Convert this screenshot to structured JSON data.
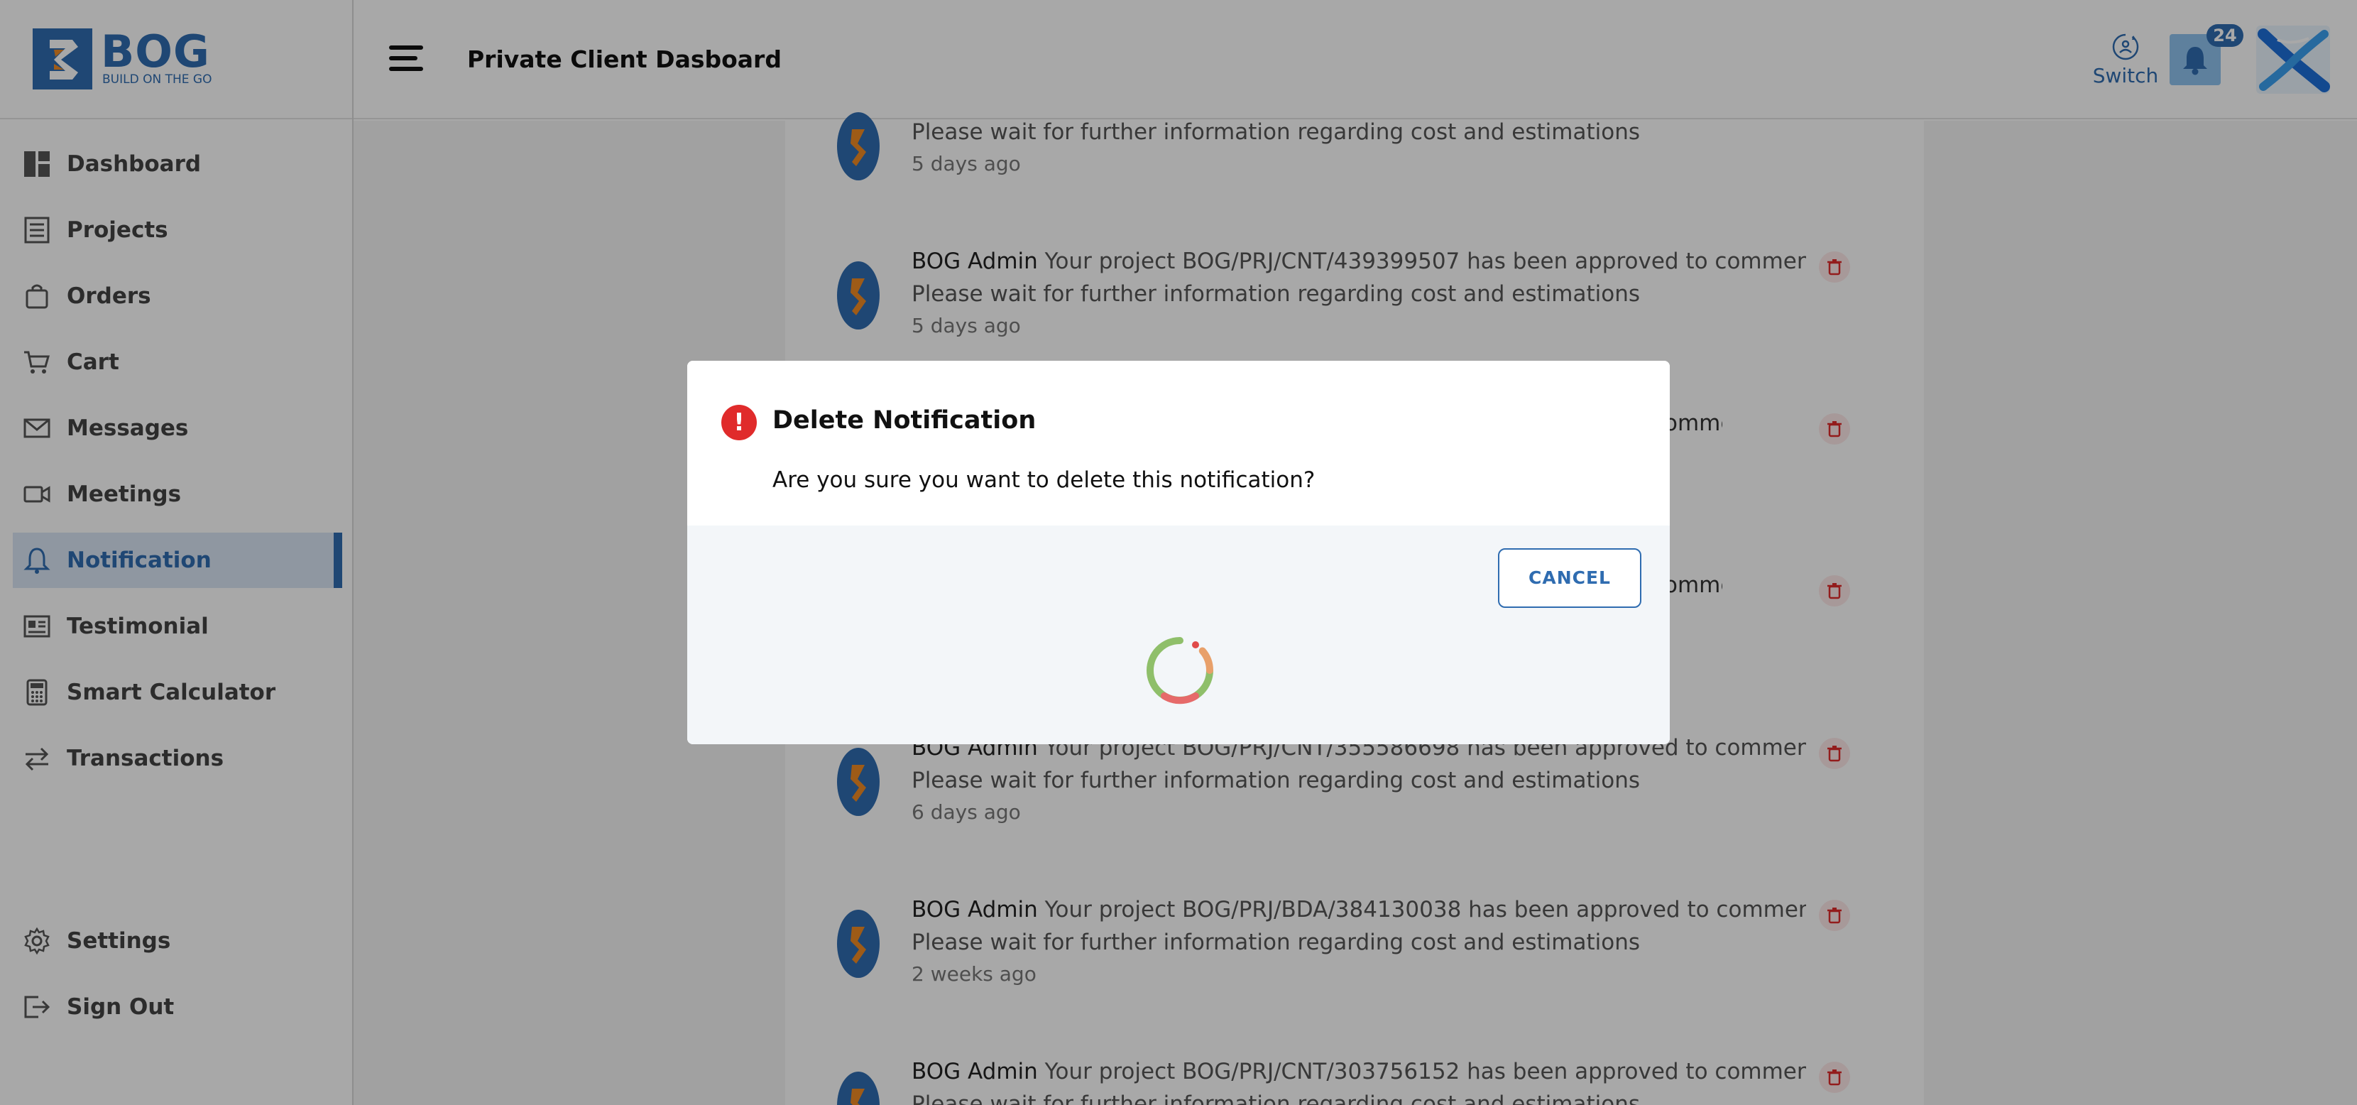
{
  "header": {
    "logo_text": "BOG",
    "logo_subtext": "BUILD ON THE GO",
    "page_title": "Private Client Dasboard",
    "switch_label": "Switch",
    "notification_count": "24"
  },
  "sidebar": {
    "items": [
      {
        "label": "Dashboard",
        "icon": "dashboard-icon"
      },
      {
        "label": "Projects",
        "icon": "projects-icon"
      },
      {
        "label": "Orders",
        "icon": "bag-icon"
      },
      {
        "label": "Cart",
        "icon": "cart-icon"
      },
      {
        "label": "Messages",
        "icon": "envelope-icon"
      },
      {
        "label": "Meetings",
        "icon": "video-icon"
      },
      {
        "label": "Notification",
        "icon": "bell-icon",
        "active": true
      },
      {
        "label": "Testimonial",
        "icon": "testimonial-icon"
      },
      {
        "label": "Smart Calculator",
        "icon": "calculator-icon"
      },
      {
        "label": "Transactions",
        "icon": "transfer-icon"
      }
    ],
    "bottom_items": [
      {
        "label": "Settings",
        "icon": "gear-icon"
      },
      {
        "label": "Sign Out",
        "icon": "sign-out-icon"
      }
    ]
  },
  "notifications": [
    {
      "sender": "",
      "message": "",
      "detail": "Please wait for further information regarding cost and estimations",
      "time": "5 days ago"
    },
    {
      "sender": "BOG Admin",
      "message": "Your project BOG/PRJ/CNT/439399507 has been approved to commence",
      "detail": "Please wait for further information regarding cost and estimations",
      "time": "5 days ago"
    },
    {
      "sender": "BOG Admin",
      "message": "Your project BOG/PRJ/CNT/355586698 has been approved to commence",
      "detail": "Please wait for further information regarding cost and estimations",
      "time": "6 days ago"
    },
    {
      "sender": "BOG Admin",
      "message": "Your project BOG/PRJ/BDA/384130038 has been approved to commence",
      "detail": "Please wait for further information regarding cost and estimations",
      "time": "2 weeks ago"
    },
    {
      "sender": "BOG Admin",
      "message": "Your project BOG/PRJ/CNT/303756152 has been approved to commence.",
      "detail": "Please wait for further information regarding cost and estimations",
      "time": ""
    }
  ],
  "hidden_rows_partial": [
    "to commence",
    "to commence"
  ],
  "modal": {
    "title": "Delete Notification",
    "body": "Are you sure you want to delete this notification?",
    "cancel_label": "CANCEL"
  },
  "colors": {
    "brand": "#2f6cb0",
    "error": "#e02b2b",
    "active_bg": "#d9e6f5"
  }
}
